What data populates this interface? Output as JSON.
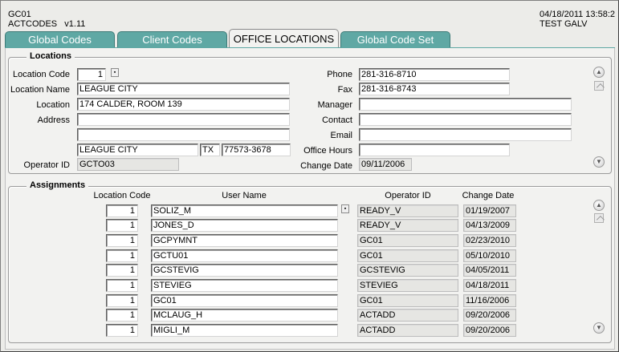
{
  "header": {
    "app_code": "GC01",
    "form_name": "ACTCODES",
    "version": "v1.11",
    "datetime": "04/18/2011 13:58:2",
    "user": "TEST GALV"
  },
  "tabs": [
    "Global Codes",
    "Client Codes",
    "OFFICE LOCATIONS",
    "Global Code Set"
  ],
  "active_tab": "OFFICE LOCATIONS",
  "locations": {
    "title": "Locations",
    "labels": {
      "location_code": "Location Code",
      "location_name": "Location Name",
      "location": "Location",
      "address": "Address",
      "operator_id": "Operator ID",
      "phone": "Phone",
      "fax": "Fax",
      "manager": "Manager",
      "contact": "Contact",
      "email": "Email",
      "office_hours": "Office Hours",
      "change_date": "Change Date"
    },
    "values": {
      "location_code": "1",
      "location_name": "LEAGUE CITY",
      "location": "174 CALDER, ROOM 139",
      "address1": "",
      "address2": "",
      "city": "LEAGUE CITY",
      "state": "TX",
      "zip": "77573-3678",
      "operator_id": "GCTO03",
      "phone": "281-316-8710",
      "fax": "281-316-8743",
      "manager": "",
      "contact": "",
      "email": "",
      "office_hours": "",
      "change_date": "09/11/2006"
    }
  },
  "assignments": {
    "title": "Assignments",
    "columns": [
      "Location Code",
      "User Name",
      "Operator ID",
      "Change Date"
    ],
    "rows": [
      {
        "code": "1",
        "user": "SOLIZ_M",
        "operator": "READY_V",
        "date": "01/19/2007"
      },
      {
        "code": "1",
        "user": "JONES_D",
        "operator": "READY_V",
        "date": "04/13/2009"
      },
      {
        "code": "1",
        "user": "GCPYMNT",
        "operator": "GC01",
        "date": "02/23/2010"
      },
      {
        "code": "1",
        "user": "GCTU01",
        "operator": "GC01",
        "date": "05/10/2010"
      },
      {
        "code": "1",
        "user": "GCSTEVIG",
        "operator": "GCSTEVIG",
        "date": "04/05/2011"
      },
      {
        "code": "1",
        "user": "STEVIEG",
        "operator": "STEVIEG",
        "date": "04/18/2011"
      },
      {
        "code": "1",
        "user": "GC01",
        "operator": "GC01",
        "date": "11/16/2006"
      },
      {
        "code": "1",
        "user": "MCLAUG_H",
        "operator": "ACTADD",
        "date": "09/20/2006"
      },
      {
        "code": "1",
        "user": "MIGLI_M",
        "operator": "ACTADD",
        "date": "09/20/2006"
      }
    ]
  },
  "icons": {
    "lov": "lov-dropdown-icon",
    "scroll_up": "scroll-up-icon",
    "scroll_down": "scroll-down-icon",
    "page_up": "page-up-icon"
  },
  "colors": {
    "tab": "#5fa8a4",
    "active_tab": "#f2f2f0",
    "panel": "#f2f2f0"
  }
}
